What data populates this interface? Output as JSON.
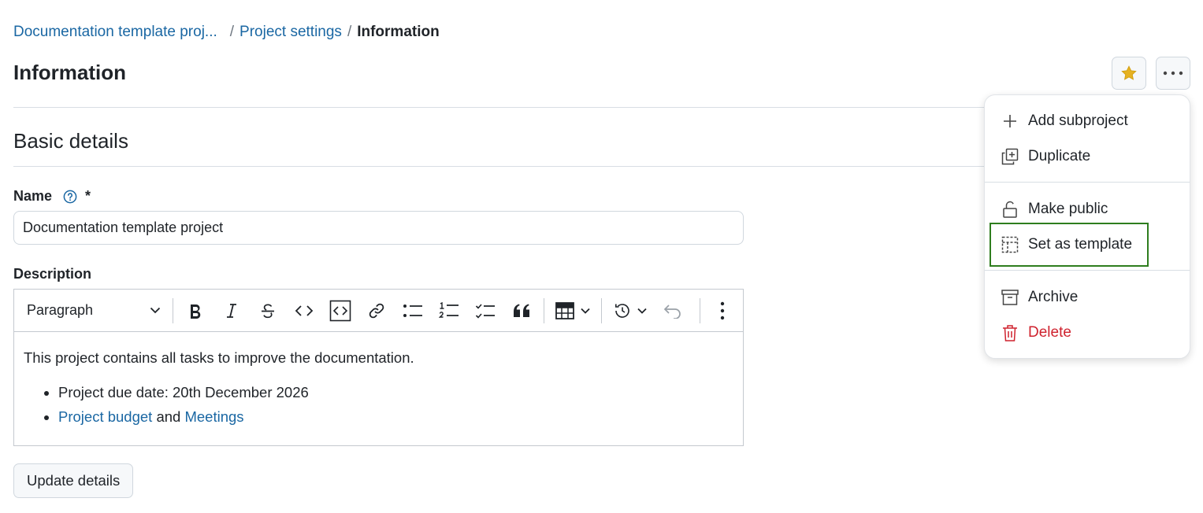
{
  "breadcrumb": {
    "items": [
      {
        "label": "Documentation template proj..."
      },
      {
        "label": "Project settings"
      }
    ],
    "separator": "/",
    "current": "Information"
  },
  "page": {
    "title": "Information"
  },
  "section": {
    "title": "Basic details"
  },
  "name_field": {
    "label": "Name",
    "required_marker": "*",
    "value": "Documentation template project"
  },
  "description_field": {
    "label": "Description",
    "paragraph_select": "Paragraph",
    "content": {
      "paragraph": "This project contains all tasks to improve the documentation.",
      "bullet_1": "Project due date: 20th December 2026",
      "bullet_2_link_1": "Project budget",
      "bullet_2_and": "and",
      "bullet_2_link_2": "Meetings"
    }
  },
  "update_button": {
    "label": "Update details"
  },
  "actions_menu": {
    "items": [
      {
        "label": "Add subproject",
        "icon": "plus-icon"
      },
      {
        "label": "Duplicate",
        "icon": "duplicate-icon"
      },
      {
        "label": "Make public",
        "icon": "unlock-icon"
      },
      {
        "label": "Set as template",
        "icon": "template-icon"
      },
      {
        "label": "Archive",
        "icon": "archive-icon"
      },
      {
        "label": "Delete",
        "icon": "trash-icon"
      }
    ]
  },
  "colors": {
    "link": "#1a67a3",
    "star": "#e6b222",
    "danger": "#cf222e",
    "highlight": "#2e7d1e"
  }
}
